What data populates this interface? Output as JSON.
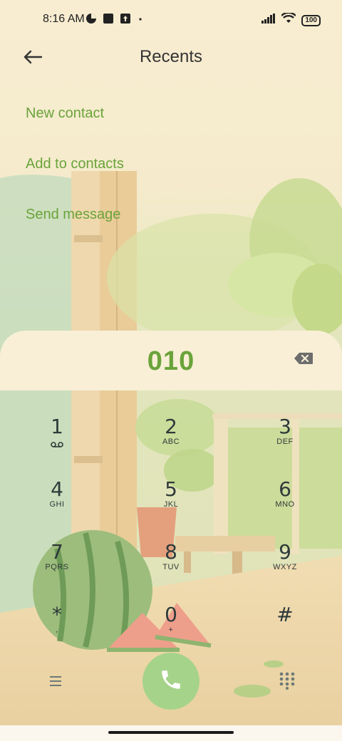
{
  "status_bar": {
    "time": "8:16 AM",
    "battery": "100",
    "icons": [
      "data-saver-icon",
      "notification-square-icon",
      "upload-icon",
      "dot-icon",
      "signal-icon",
      "wifi-icon",
      "battery-icon"
    ]
  },
  "header": {
    "title": "Recents",
    "back_icon": "arrow-left-icon"
  },
  "actions": {
    "new_contact": "New contact",
    "add_to_contacts": "Add to contacts",
    "send_message": "Send message"
  },
  "dialer": {
    "number": "010",
    "backspace_icon": "backspace-icon"
  },
  "keys": [
    {
      "digit": "1",
      "letters": ""
    },
    {
      "digit": "2",
      "letters": "ABC"
    },
    {
      "digit": "3",
      "letters": "DEF"
    },
    {
      "digit": "4",
      "letters": "GHI"
    },
    {
      "digit": "5",
      "letters": "JKL"
    },
    {
      "digit": "6",
      "letters": "MNO"
    },
    {
      "digit": "7",
      "letters": "PQRS"
    },
    {
      "digit": "8",
      "letters": "TUV"
    },
    {
      "digit": "9",
      "letters": "WXYZ"
    },
    {
      "digit": "*",
      "letters": ","
    },
    {
      "digit": "0",
      "letters": "+"
    },
    {
      "digit": "#",
      "letters": ""
    }
  ],
  "bottom": {
    "menu_icon": "menu-icon",
    "call_icon": "phone-icon",
    "dialpad_icon": "dialpad-icon"
  },
  "colors": {
    "accent_green": "#6aa33a",
    "call_button": "#a6d38a",
    "panel": "#f8efd6"
  }
}
